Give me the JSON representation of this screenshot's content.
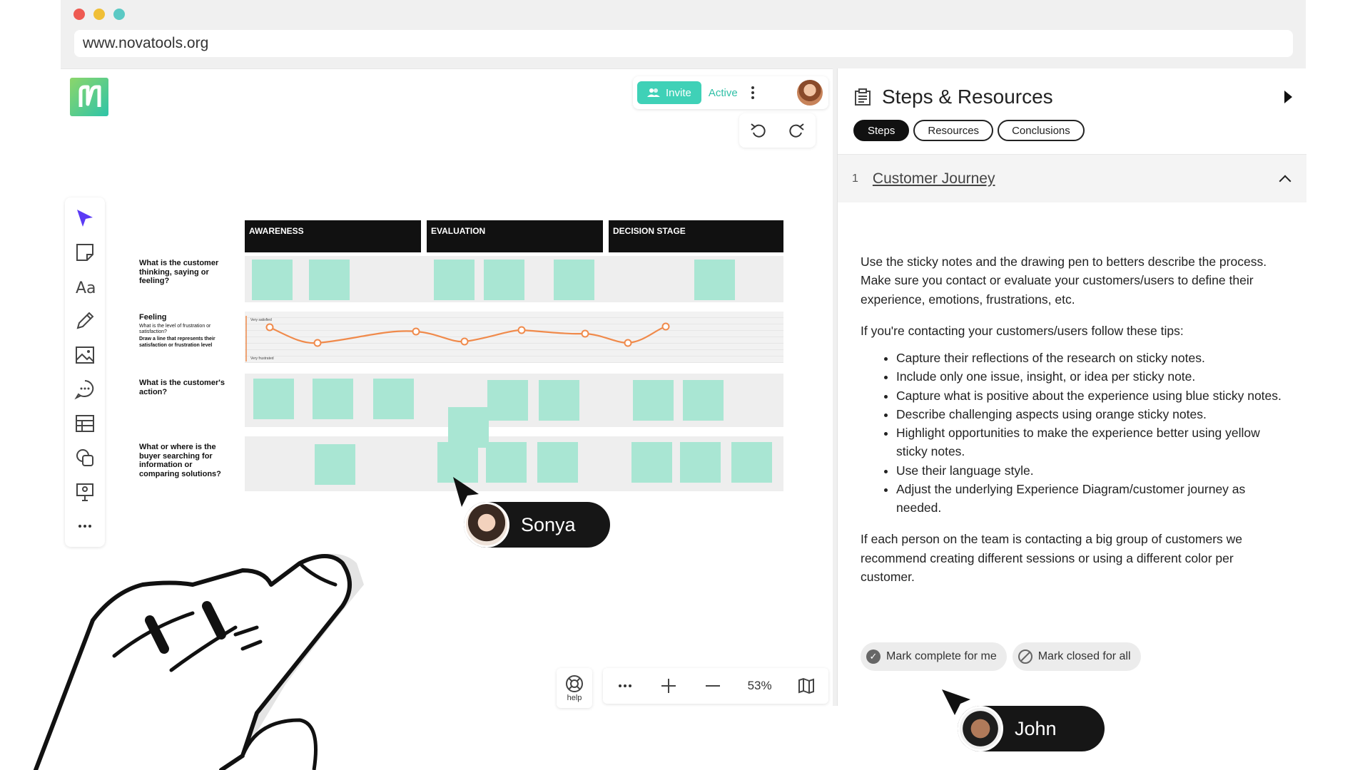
{
  "browser": {
    "url": "www.novatools.org"
  },
  "topbar": {
    "invite_label": "Invite",
    "status_label": "Active"
  },
  "board": {
    "stages": [
      "AWARENESS",
      "EVALUATION",
      "DECISION STAGE"
    ],
    "rows": {
      "thinking": "What is the customer thinking, saying or feeling?",
      "feeling_title": "Feeling",
      "feeling_sub": "What is the level of frustration or satisfaction?",
      "feeling_instr": "Draw a line that represents their satisfaction or frustration level",
      "action": "What is the customer's action?",
      "searching": "What or where is the buyer searching for information or comparing solutions?"
    },
    "chart": {
      "top_label": "Very satisfied",
      "bottom_label": "Very frustrated"
    }
  },
  "cursors": {
    "sonya": "Sonya",
    "john": "John"
  },
  "controls": {
    "help_label": "help",
    "zoom": "53%"
  },
  "panel": {
    "title": "Steps & Resources",
    "tabs": [
      "Steps",
      "Resources",
      "Conclusions"
    ],
    "section": {
      "number": "1",
      "title": "Customer Journey"
    },
    "paragraph1": "Use the sticky notes and the drawing pen to betters describe the process. Make sure you contact or evaluate your customers/users to define their experience, emotions, frustrations, etc.",
    "paragraph2": "If you're contacting your customers/users follow these tips:",
    "tips": [
      "Capture their reflections of the research on sticky notes.",
      "Include only one issue, insight, or idea per sticky note.",
      "Capture what is positive about the experience using blue sticky notes.",
      "Describe challenging aspects using orange sticky notes.",
      "Highlight opportunities to make the experience better using yellow sticky notes.",
      "Use their language style.",
      "Adjust the underlying Experience Diagram/customer journey as needed."
    ],
    "paragraph3": "If each person on the team is contacting a big group of customers we recommend creating different sessions or using a different color per customer.",
    "mark_complete": "Mark complete for me",
    "mark_closed": "Mark closed for all"
  },
  "colors": {
    "accent": "#3fd1b7",
    "sticky": "#a9e6d3",
    "line": "#f08a4b",
    "dark": "#111111"
  }
}
